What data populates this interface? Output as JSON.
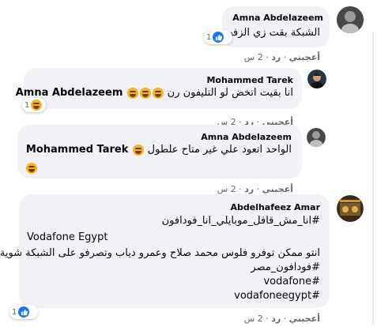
{
  "comments": [
    {
      "author": "Amna Abdelazeem",
      "text": "الشبكة بقت زي الزفت",
      "reaction_count": "1",
      "actions": {
        "like": "أعجبني",
        "reply": "رد",
        "time": "2 س"
      }
    },
    {
      "author": "Mohammed Tarek",
      "mention": "Amna Abdelazeem",
      "text": "انا بقيت اتخض لو التليفون رن",
      "reaction_count": "1",
      "actions": {
        "like": "أعجبني",
        "reply": "رد",
        "time": "2 س"
      }
    },
    {
      "author": "Amna Abdelazeem",
      "mention": "Mohammed Tarek",
      "text": "الواحد اتعود علي غير متاح علطول",
      "actions": {
        "like": "أعجبني",
        "reply": "رد",
        "time": "2 س"
      }
    },
    {
      "author": "Abdelhafeez Amar",
      "lines": [
        "#انا_مش_قافل_موبايلي_انا_فودافون",
        "Vodafone Egypt",
        "انتو ممكن توفرو فلوس محمد صلاح وعمرو دياب وتصرفو على الشبكة شوية",
        "#فودافون_مصر",
        "#vodafone",
        "#vodafoneegypt"
      ],
      "reaction_count": "1",
      "actions": {
        "like": "أعجبني",
        "reply": "رد",
        "time": "2 س"
      }
    }
  ],
  "colors": {
    "like_blue": "#1877f2",
    "haha_yellow": "#f7b125",
    "bubble": "#f0f2f5",
    "meta": "#65676b"
  },
  "icons": [
    "like-icon",
    "haha-icon"
  ]
}
